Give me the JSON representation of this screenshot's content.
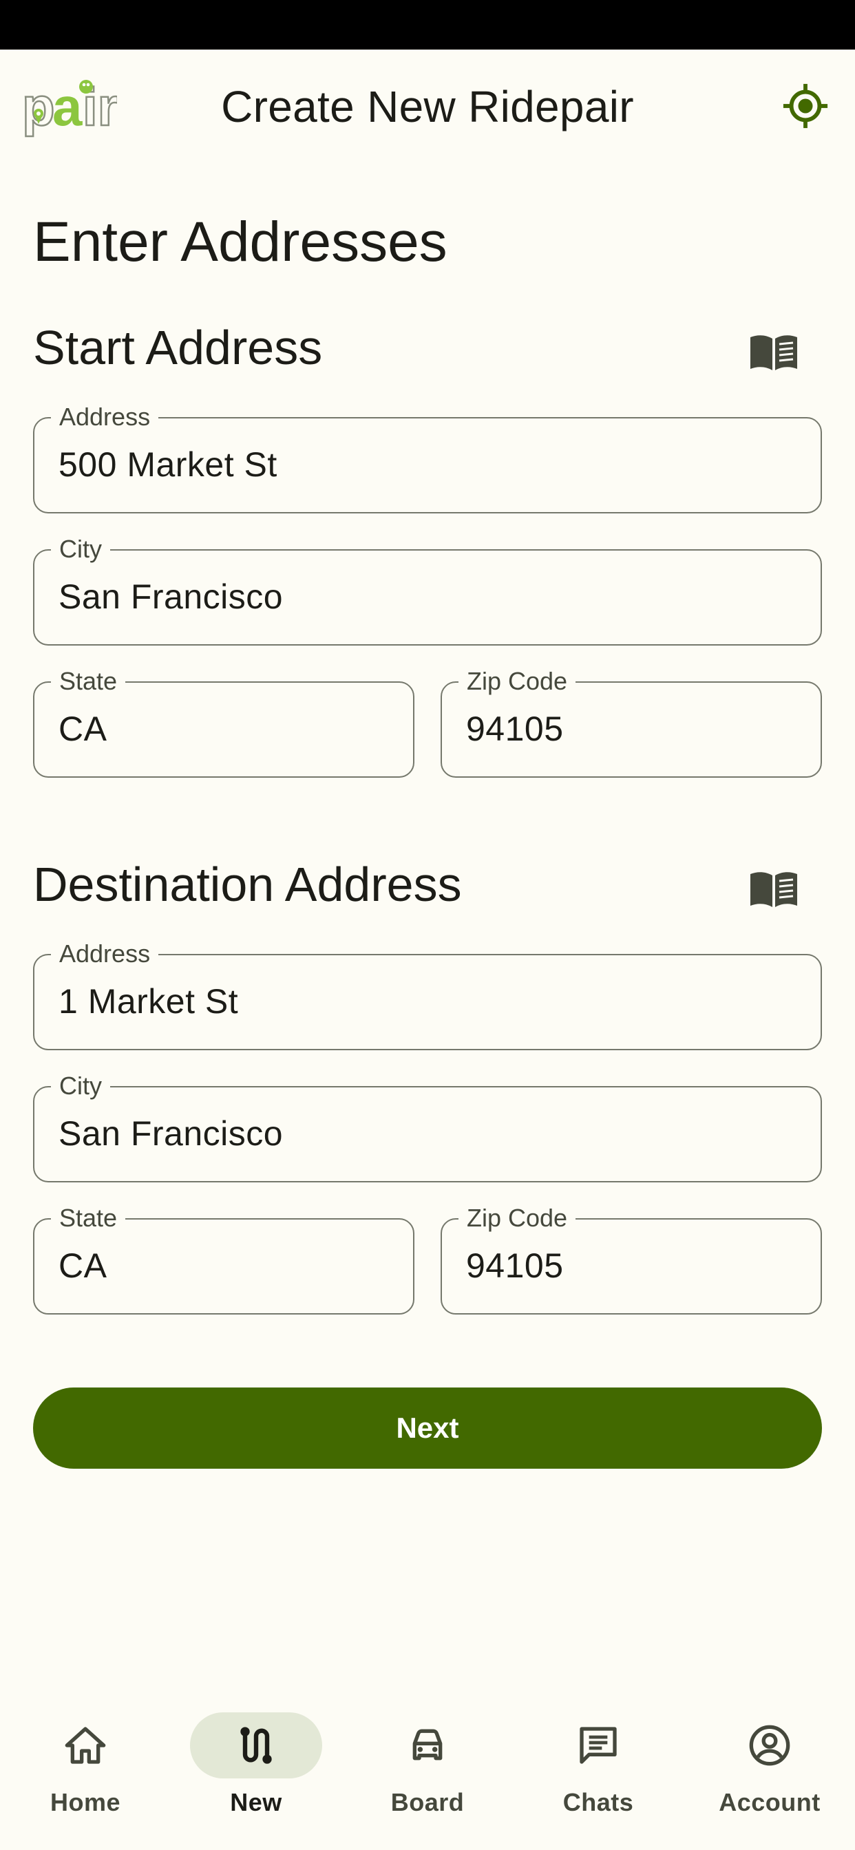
{
  "app_bar": {
    "logo_text": "pair",
    "title": "Create New Ridepair",
    "locate_icon": "my-location-icon"
  },
  "page_heading": "Enter Addresses",
  "start": {
    "title": "Start Address",
    "address_book_icon": "address-book-icon",
    "address": {
      "label": "Address",
      "value": "500 Market St"
    },
    "city": {
      "label": "City",
      "value": "San Francisco"
    },
    "state": {
      "label": "State",
      "value": "CA"
    },
    "zip": {
      "label": "Zip Code",
      "value": "94105"
    }
  },
  "destination": {
    "title": "Destination Address",
    "address_book_icon": "address-book-icon",
    "address": {
      "label": "Address",
      "value": "1 Market St"
    },
    "city": {
      "label": "City",
      "value": "San Francisco"
    },
    "state": {
      "label": "State",
      "value": "CA"
    },
    "zip": {
      "label": "Zip Code",
      "value": "94105"
    }
  },
  "next_label": "Next",
  "nav": {
    "active": "New",
    "items": [
      {
        "label": "Home",
        "icon": "home-icon"
      },
      {
        "label": "New",
        "icon": "route-icon"
      },
      {
        "label": "Board",
        "icon": "car-icon"
      },
      {
        "label": "Chats",
        "icon": "chat-icon"
      },
      {
        "label": "Account",
        "icon": "account-circle-icon"
      }
    ]
  },
  "colors": {
    "background": "#fdfcf5",
    "primary": "#426900",
    "logo_green": "#8cc63f",
    "outline": "#75786c",
    "nav_indicator": "#e3e8d6"
  }
}
